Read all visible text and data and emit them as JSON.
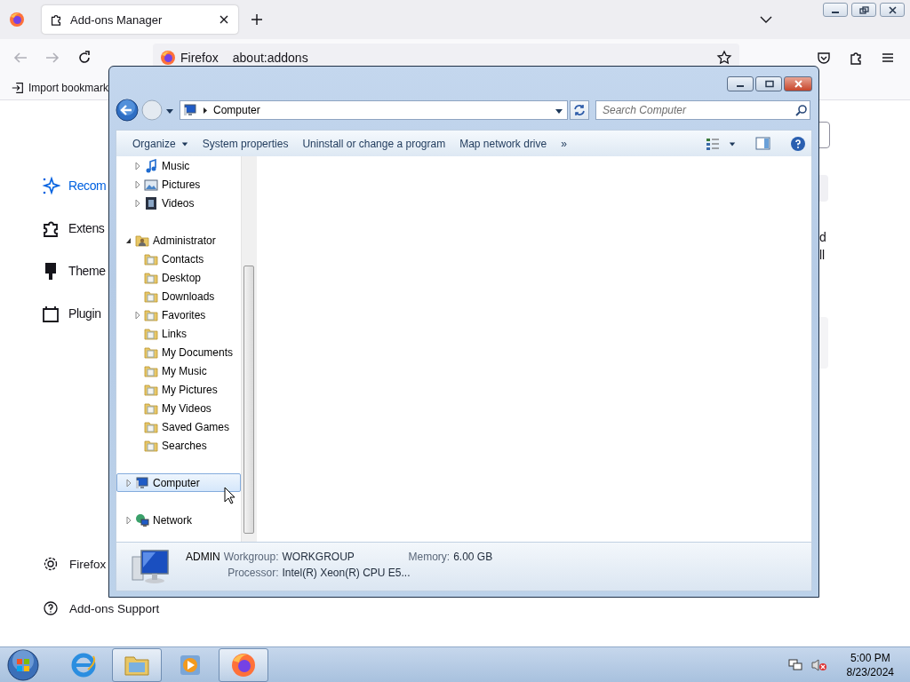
{
  "browser": {
    "tabs": [
      {
        "label": "Add-ons Manager",
        "selected": true
      }
    ],
    "url_identity": "Firefox",
    "url": "about:addons",
    "bookmarks": [
      {
        "label": "Import bookmark"
      }
    ],
    "categories": [
      {
        "label": "Recom",
        "kind": "recommendations",
        "selected": true
      },
      {
        "label": "Extens",
        "kind": "extensions",
        "selected": false
      },
      {
        "label": "Theme",
        "kind": "themes",
        "selected": false
      },
      {
        "label": "Plugin",
        "kind": "plugins",
        "selected": false
      }
    ],
    "footer_links": [
      {
        "label": "Firefox",
        "kind": "settings"
      },
      {
        "label": "Add-ons Support",
        "kind": "support"
      }
    ],
    "page_fragments": [
      "d",
      "ll"
    ]
  },
  "explorer": {
    "address": [
      "Computer"
    ],
    "search": {
      "placeholder": "Search Computer"
    },
    "toolbar": [
      {
        "label": "Organize",
        "kind": "menu"
      },
      {
        "label": "System properties",
        "kind": "button"
      },
      {
        "label": "Uninstall or change a program",
        "kind": "button"
      },
      {
        "label": "Map network drive",
        "kind": "button"
      },
      {
        "label": "»",
        "kind": "button"
      }
    ],
    "tree": [
      {
        "children": [
          {
            "label": "Music",
            "kind": "music",
            "expanded": false,
            "selected": false
          },
          {
            "label": "Pictures",
            "kind": "pictures",
            "expanded": false,
            "selected": false
          },
          {
            "label": "Videos",
            "kind": "videos",
            "expanded": false,
            "selected": false
          }
        ]
      },
      {
        "label": "Administrator",
        "kind": "user",
        "expanded": true,
        "selected": false,
        "children": [
          {
            "label": "Contacts",
            "kind": "folder",
            "selected": false
          },
          {
            "label": "Desktop",
            "kind": "folder",
            "selected": false
          },
          {
            "label": "Downloads",
            "kind": "folder",
            "selected": false
          },
          {
            "label": "Favorites",
            "kind": "folder",
            "expanded": false,
            "selected": false
          },
          {
            "label": "Links",
            "kind": "folder",
            "selected": false
          },
          {
            "label": "My Documents",
            "kind": "folder",
            "selected": false
          },
          {
            "label": "My Music",
            "kind": "folder",
            "selected": false
          },
          {
            "label": "My Pictures",
            "kind": "folder",
            "selected": false
          },
          {
            "label": "My Videos",
            "kind": "folder",
            "selected": false
          },
          {
            "label": "Saved Games",
            "kind": "folder",
            "selected": false
          },
          {
            "label": "Searches",
            "kind": "folder",
            "selected": false
          }
        ]
      },
      {
        "label": "Computer",
        "kind": "computer",
        "expanded": false,
        "selected": true
      },
      {
        "label": "Network",
        "kind": "network",
        "expanded": false,
        "selected": false
      }
    ],
    "details": {
      "name": "ADMIN",
      "fields": [
        {
          "label": "Workgroup:",
          "value": "WORKGROUP"
        },
        {
          "label": "Memory:",
          "value": "6.00 GB"
        },
        {
          "label": "Processor:",
          "value": "Intel(R) Xeon(R) CPU E5..."
        }
      ]
    }
  },
  "taskbar": {
    "apps": [
      {
        "kind": "browser-e",
        "active": false
      },
      {
        "kind": "folder",
        "active": true
      },
      {
        "kind": "media",
        "active": false
      },
      {
        "kind": "firefox",
        "active": true
      }
    ],
    "time": "5:00 PM",
    "date": "8/23/2024"
  }
}
